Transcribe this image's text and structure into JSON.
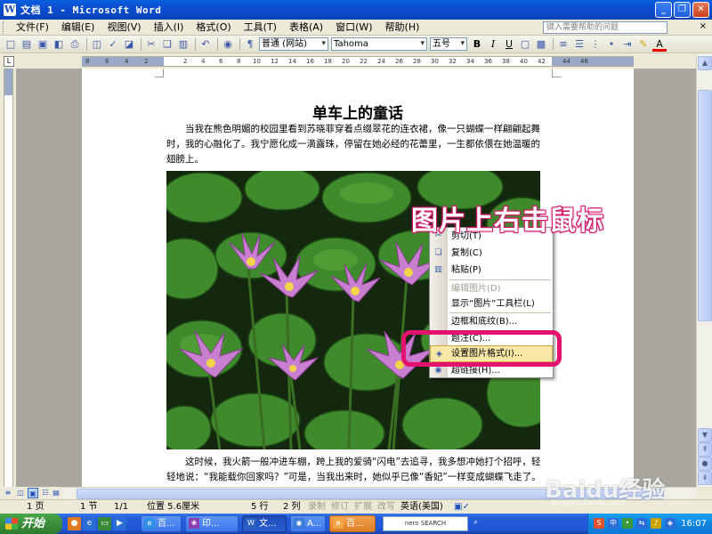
{
  "window": {
    "title": "文档 1 - Microsoft Word",
    "app_icon": "W"
  },
  "menubar": {
    "items": [
      "文件(F)",
      "编辑(E)",
      "视图(V)",
      "插入(I)",
      "格式(O)",
      "工具(T)",
      "表格(A)",
      "窗口(W)",
      "帮助(H)"
    ],
    "help_placeholder": "键入需要帮助的问题",
    "close_glyph": "×"
  },
  "toolbar": {
    "style_value": "普通 (网站)",
    "font_value": "Tahoma",
    "size_value": "五号",
    "bold_label": "B",
    "italic_label": "I",
    "underline_label": "U",
    "font_color_label": "A"
  },
  "ruler": {
    "ticks": [
      "8",
      "6",
      "4",
      "2",
      "2",
      "4",
      "6",
      "8",
      "10",
      "12",
      "14",
      "16",
      "18",
      "20",
      "22",
      "24",
      "26",
      "28",
      "30",
      "32",
      "34",
      "36",
      "38",
      "40",
      "42",
      "44",
      "46"
    ]
  },
  "document": {
    "title": "单车上的童话",
    "para1": "当我在熊色明媚的校园里看到苏晓菲穿着点缀翠花的连衣裙，像一只蝴蝶一样翩翩起舞时，我的心融化了。我宁愿化成一滴露珠，停留在她必经的花蕾里，一生都依偎在她温暖的翅膀上。",
    "para2": "这时候，我火箭一般冲进车棚，跨上我的爱骑“闪电”去追寻，我多想冲她打个招呼，轻轻地说：“我能载你回家吗？”可是，当我出来时，她似乎已像“香妃”一样变成蝴蝶飞走了。"
  },
  "context_menu": {
    "items": [
      {
        "label": "剪切(T)",
        "icon": "scissors-icon",
        "state": "normal"
      },
      {
        "label": "复制(C)",
        "icon": "copy-icon",
        "state": "normal"
      },
      {
        "label": "粘贴(P)",
        "icon": "paste-icon",
        "state": "normal"
      },
      {
        "label": "编辑图片(D)",
        "icon": "",
        "state": "disabled"
      },
      {
        "label": "显示“图片”工具栏(L)",
        "icon": "",
        "state": "normal"
      },
      {
        "label": "边框和底纹(B)...",
        "icon": "",
        "state": "normal"
      },
      {
        "label": "题注(C)...",
        "icon": "",
        "state": "normal"
      },
      {
        "label": "设置图片格式(I)...",
        "icon": "format-picture-icon",
        "state": "hover"
      },
      {
        "label": "超链接(H)...",
        "icon": "hyperlink-icon",
        "state": "normal"
      }
    ]
  },
  "annotation": {
    "text": "图片上右击鼠标",
    "color": "#e4126e"
  },
  "statusbar": {
    "page": "1 页",
    "section": "1 节",
    "page_of": "1/1",
    "position": "位置 5.6厘米",
    "line": "5 行",
    "column": "2 列",
    "rec": "录制",
    "trk": "修订",
    "ext": "扩展",
    "ovr": "改写",
    "language": "英语(美国)"
  },
  "taskbar": {
    "start_label": "开始",
    "tasks": [
      {
        "label": "百...",
        "color": "#2f8fe6",
        "state": "normal"
      },
      {
        "label": "印...",
        "color": "#8a3fb0",
        "state": "normal"
      },
      {
        "label": "文...",
        "color": "#2b5fc0",
        "state": "active"
      },
      {
        "label": "A...",
        "color": "#3a7ad8",
        "state": "normal"
      },
      {
        "label": "百...",
        "color": "#e07f24",
        "state": "orange"
      }
    ],
    "clock": "16:07"
  },
  "watermark": {
    "text": "Baidu经验",
    "sub": "jingyan.baidu.com"
  },
  "colors": {
    "title_bar": "#0b4fd0",
    "menu_hover": "#f9e7a6",
    "ring": "#e4126e",
    "taskbar": "#245edb",
    "start": "#3c8e3c"
  }
}
